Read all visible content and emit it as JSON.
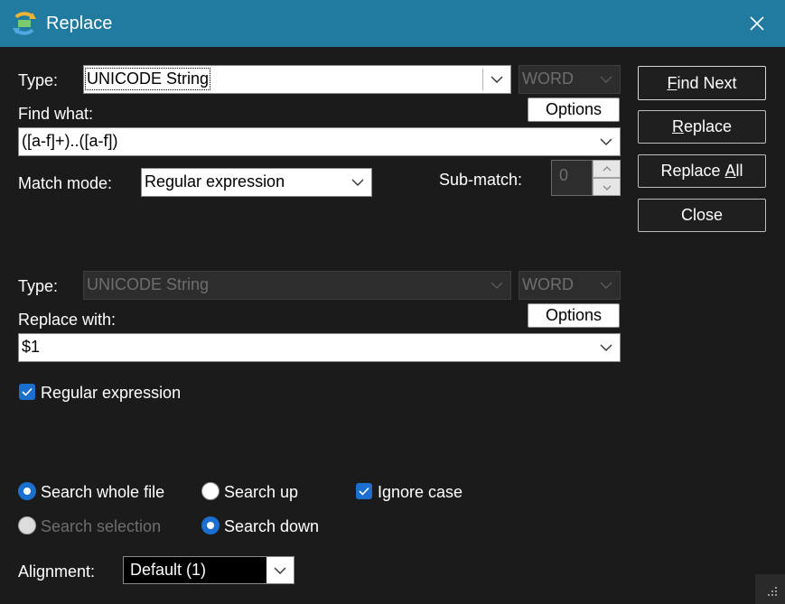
{
  "window": {
    "title": "Replace"
  },
  "find": {
    "type_label": "Type:",
    "type_value": "UNICODE String",
    "word_value": "WORD",
    "find_label": "Find what:",
    "find_value": "([a-f]+)..([a-f])",
    "options_label": "Options",
    "match_mode_label": "Match mode:",
    "match_mode_value": "Regular expression",
    "submatch_label": "Sub-match:",
    "submatch_value": "0"
  },
  "replace": {
    "type_label": "Type:",
    "type_value": "UNICODE String",
    "word_value": "WORD",
    "with_label": "Replace with:",
    "with_value": "$1",
    "options_label": "Options",
    "regex_label": "Regular expression",
    "regex_checked": true
  },
  "buttons": {
    "find_next_pre": "F",
    "find_next_key": "i",
    "find_next_post": "nd Next",
    "replace_key": "R",
    "replace_post": "eplace",
    "replace_all_pre": "Replace ",
    "replace_all_key": "A",
    "replace_all_post": "ll",
    "close": "Close"
  },
  "options": {
    "search_whole_file": "Search whole file",
    "search_selection": "Search selection",
    "search_up": "Search up",
    "search_down": "Search down",
    "ignore_case": "Ignore case",
    "ignore_case_checked": true,
    "selected_scope": "Search whole file",
    "selected_direction": "Search down"
  },
  "alignment": {
    "label": "Alignment:",
    "value": "Default (1)"
  },
  "colors": {
    "titlebar": "#217aa0",
    "background": "#1b1b1b",
    "accent": "#1a6fd0"
  }
}
